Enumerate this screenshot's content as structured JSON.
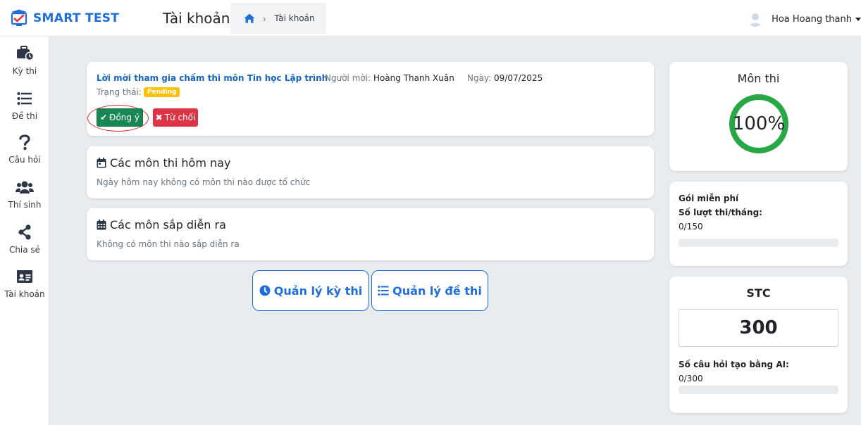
{
  "brand": {
    "name": "SMART TEST"
  },
  "header": {
    "title": "Tài khoản",
    "breadcrumb": {
      "home_icon": "home-icon",
      "current": "Tài khoản"
    },
    "user": {
      "name": "Hoa Hoang thanh"
    }
  },
  "sidebar": {
    "items": [
      {
        "label": "Kỳ thi",
        "icon": "briefcase-clock-icon"
      },
      {
        "label": "Đề thi",
        "icon": "list-icon"
      },
      {
        "label": "Câu hỏi",
        "icon": "question-icon"
      },
      {
        "label": "Thí sinh",
        "icon": "users-icon"
      },
      {
        "label": "Chia sẻ",
        "icon": "share-icon"
      },
      {
        "label": "Tài khoản",
        "icon": "id-card-icon"
      }
    ]
  },
  "invitation": {
    "title": "Lời mời tham gia chấm thi môn Tin học Lập trình",
    "inviter_label": "Người mời:",
    "inviter": "Hoàng Thanh Xuân",
    "date_label": "Ngày:",
    "date": "09/07/2025",
    "status_label": "Trạng thái:",
    "status": "Pending",
    "accept_label": "Đồng ý",
    "reject_label": "Từ chối"
  },
  "today": {
    "title": "Các môn thi hôm nay",
    "text": "Ngày hôm nay không có môn thi nào được tổ chức"
  },
  "upcoming": {
    "title": "Các môn sắp diễn ra",
    "text": "Không có môn thi nào sắp diễn ra"
  },
  "actions": {
    "manage_exams": "Quản lý kỳ thi",
    "manage_tests": "Quản lý đề thi"
  },
  "subject_stat": {
    "title": "Môn thi",
    "percent_label": "100%",
    "percent": 100,
    "color": "#28a745"
  },
  "plan": {
    "name": "Gói miễn phí",
    "usage_label": "Số lượt thi/tháng:",
    "usage": "0/150",
    "usage_fraction": 0
  },
  "stc": {
    "title": "STC",
    "value": "300",
    "ai_label": "Số câu hỏi tạo bằng AI:",
    "ai_usage": "0/300",
    "ai_fraction": 0
  },
  "colors": {
    "brand": "#1e6fd9",
    "accept": "#198754",
    "reject": "#dc3545",
    "pending": "#ffc107",
    "invite_title": "#1565c0"
  }
}
